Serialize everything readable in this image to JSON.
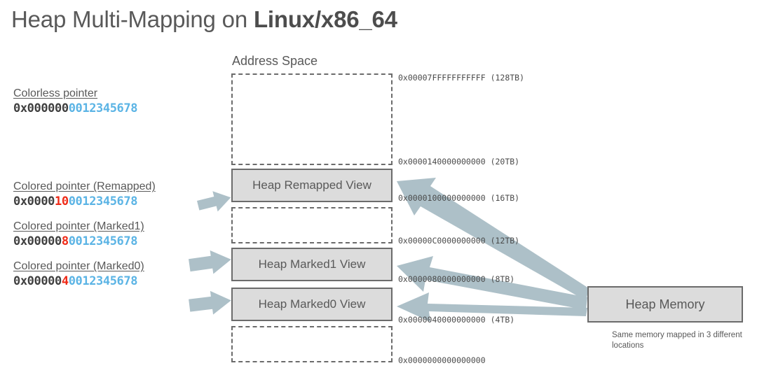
{
  "title": {
    "plain": "Heap Multi-Mapping on ",
    "bold": "Linux/x86_64"
  },
  "address_space": {
    "label": "Address Space"
  },
  "pointers": [
    {
      "title": "Colorless pointer",
      "prefix": "0x000000",
      "color_nibble": "",
      "suffix": "0012345678"
    },
    {
      "title": "Colored pointer (Remapped)",
      "prefix": "0x0000",
      "color_nibble": "10",
      "suffix": "0012345678"
    },
    {
      "title": "Colored pointer (Marked1)",
      "prefix": "0x00000",
      "color_nibble": "8",
      "suffix": "0012345678"
    },
    {
      "title": "Colored pointer (Marked0)",
      "prefix": "0x00000",
      "color_nibble": "4",
      "suffix": "0012345678"
    }
  ],
  "views": [
    {
      "label": "Heap Remapped View"
    },
    {
      "label": "Heap Marked1 View"
    },
    {
      "label": "Heap Marked0 View"
    }
  ],
  "heap_memory": {
    "label": "Heap Memory",
    "caption": "Same memory mapped in 3 different locations"
  },
  "addresses": [
    {
      "hex": "0x00007FFFFFFFFFFF",
      "size": "(128TB)"
    },
    {
      "hex": "0x0000140000000000",
      "size": "(20TB)"
    },
    {
      "hex": "0x0000100000000000",
      "size": "(16TB)"
    },
    {
      "hex": "0x00000C0000000000",
      "size": "(12TB)"
    },
    {
      "hex": "0x0000080000000000",
      "size": "(8TB)"
    },
    {
      "hex": "0x0000040000000000",
      "size": "(4TB)"
    },
    {
      "hex": "0x0000000000000000",
      "size": ""
    }
  ],
  "colors": {
    "arrow": "#adc0c8",
    "box_fill": "#dcdcdc",
    "box_border": "#6b6b6b",
    "text": "#595959",
    "pointer_dark": "#404040",
    "pointer_red": "#ef2b18",
    "pointer_blue": "#5bb4e5"
  }
}
